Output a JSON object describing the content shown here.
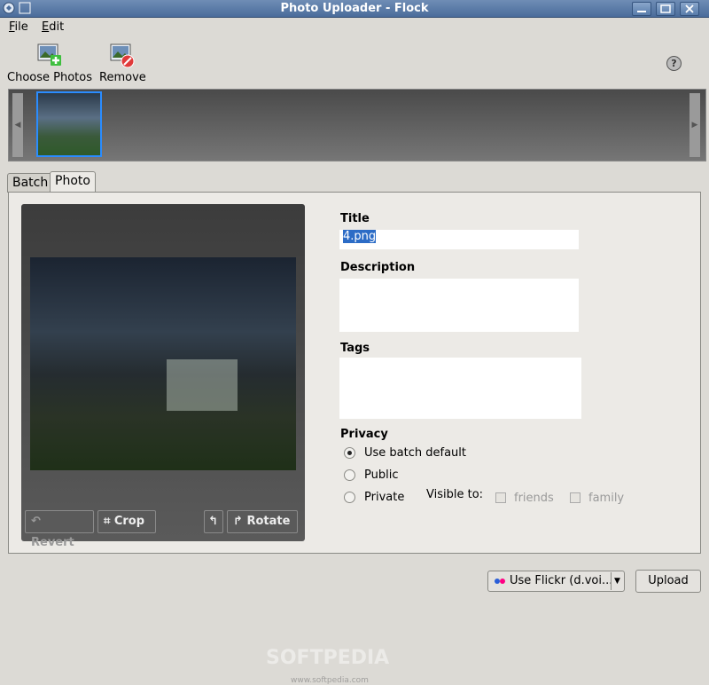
{
  "window": {
    "title": "Photo Uploader - Flock"
  },
  "menu": [
    {
      "label_pre": "",
      "mnemonic": "F",
      "label_post": "ile"
    },
    {
      "label_pre": "",
      "mnemonic": "E",
      "label_post": "dit"
    }
  ],
  "toolbar": {
    "choose_label": "Choose Photos",
    "remove_label": "Remove"
  },
  "tabs": [
    "Batch",
    "Photo"
  ],
  "preview": {
    "revert_label": "Revert",
    "crop_label": "Crop",
    "rotate_label": "Rotate"
  },
  "form": {
    "title_label": "Title",
    "title_value": "4.png",
    "description_label": "Description",
    "tags_label": "Tags",
    "privacy_label": "Privacy",
    "privacy_options": [
      "Use batch default",
      "Public",
      "Private"
    ],
    "privacy_selected": "Use batch default",
    "visible_to_label": "Visible to:",
    "friends_label": "friends",
    "family_label": "family"
  },
  "footer": {
    "account_label": "Use Flickr (d.voi...",
    "upload_label": "Upload"
  },
  "watermark": {
    "brand": "SOFTPEDIA",
    "url": "www.softpedia.com"
  },
  "colors": {
    "selection": "#2c6cc6",
    "titlebar": "#4a6c9b",
    "thumb_border": "#2a8cff"
  }
}
